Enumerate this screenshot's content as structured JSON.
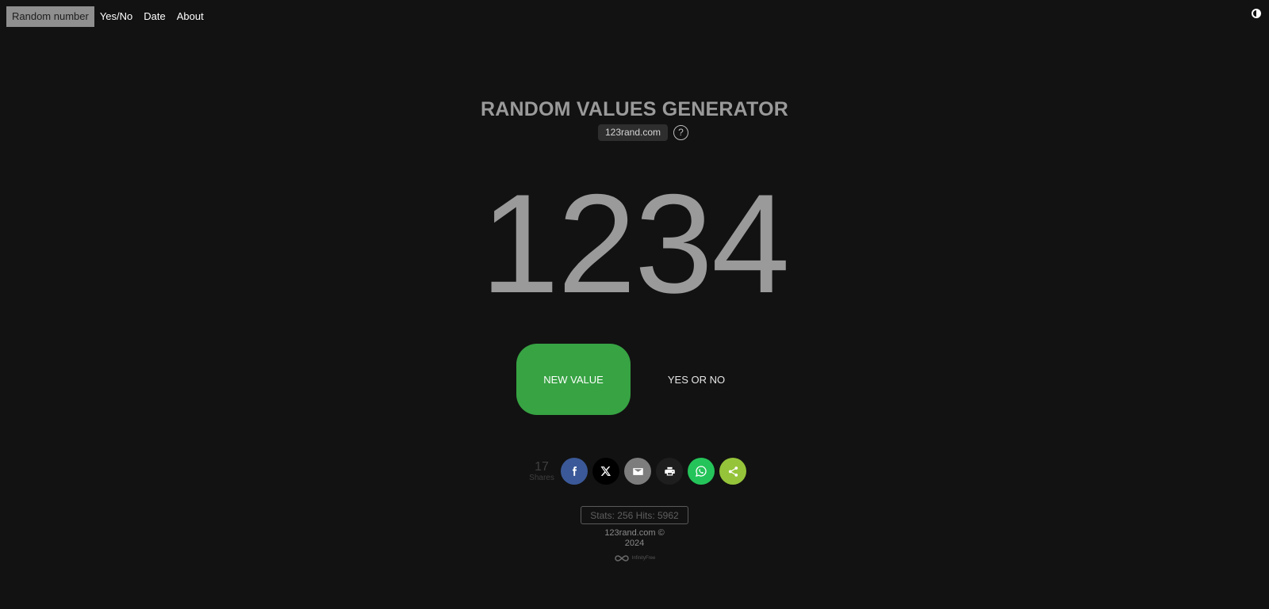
{
  "nav": {
    "items": [
      {
        "label": "Random number",
        "active": true
      },
      {
        "label": "Yes/No",
        "active": false
      },
      {
        "label": "Date",
        "active": false
      },
      {
        "label": "About",
        "active": false
      }
    ],
    "theme_toggle_icon": "half-moon-icon"
  },
  "header": {
    "title": "RANDOM VALUES GENERATOR",
    "site_badge": "123rand.com",
    "help_symbol": "?"
  },
  "result": {
    "value": "1234"
  },
  "actions": {
    "new_value_label": "NEW VALUE",
    "yes_or_no_label": "YES OR NO",
    "new_value_color": "#37a343"
  },
  "share": {
    "count": "17",
    "count_label": "Shares",
    "buttons": [
      {
        "name": "facebook",
        "icon": "facebook-icon",
        "color": "#3b5998"
      },
      {
        "name": "x",
        "icon": "x-icon",
        "color": "#000000"
      },
      {
        "name": "email",
        "icon": "email-icon",
        "color": "#7d7d7d"
      },
      {
        "name": "print",
        "icon": "print-icon",
        "color": "#1e1e1e"
      },
      {
        "name": "whatsapp",
        "icon": "whatsapp-icon",
        "color": "#25c45a"
      },
      {
        "name": "share",
        "icon": "share-icon",
        "color": "#95c43a"
      }
    ]
  },
  "footer": {
    "stats": "Stats: 256 Hits: 5962",
    "copyright_line1": "123rand.com ©",
    "copyright_line2": "2024",
    "powered_by": "InfinityFree"
  }
}
